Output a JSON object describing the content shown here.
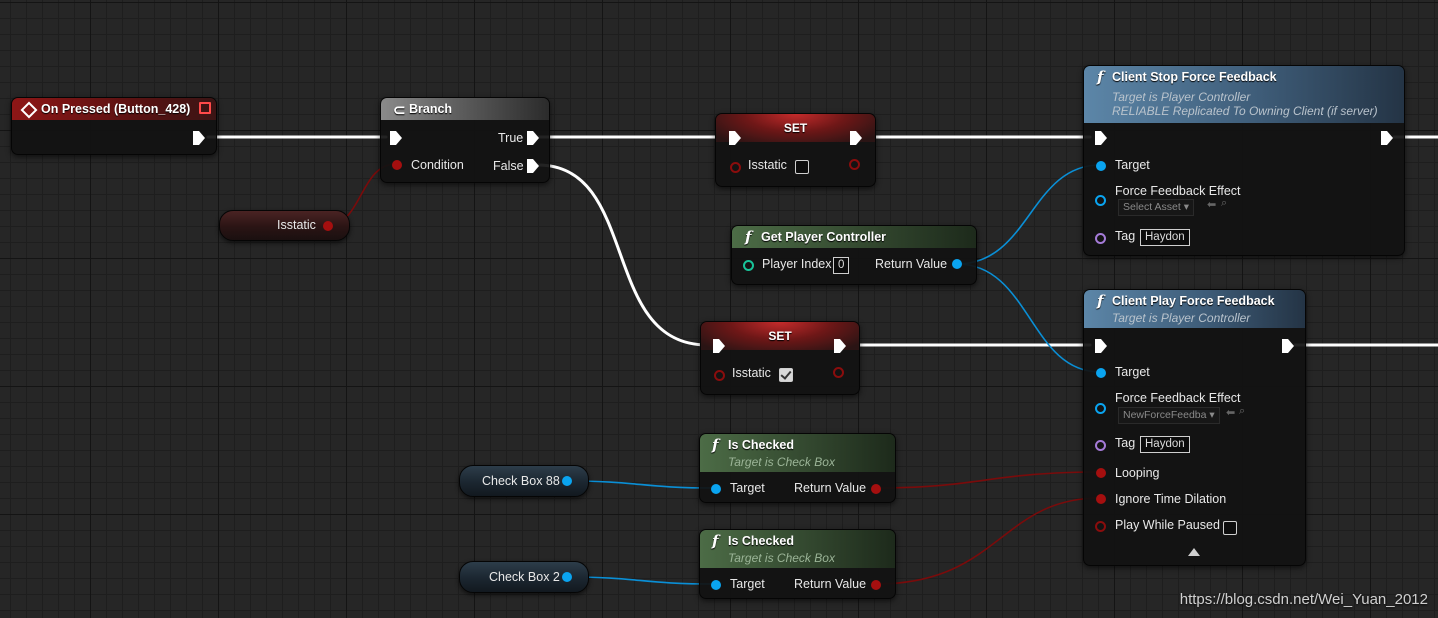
{
  "on_pressed": {
    "title": "On Pressed (Button_428)"
  },
  "branch": {
    "title": "Branch",
    "true_label": "True",
    "false_label": "False",
    "condition_label": "Condition"
  },
  "isstatic_var": {
    "label": "Isstatic"
  },
  "set_top": {
    "title": "SET",
    "var_label": "Isstatic",
    "checked": false
  },
  "set_bottom": {
    "title": "SET",
    "var_label": "Isstatic",
    "checked": true
  },
  "get_player_controller": {
    "title": "Get Player Controller",
    "player_index_label": "Player Index",
    "player_index_value": "0",
    "return_label": "Return Value"
  },
  "client_stop": {
    "title": "Client Stop Force Feedback",
    "subtitle1": "Target is Player Controller",
    "subtitle2": "RELIABLE Replicated To Owning Client (if server)",
    "target_label": "Target",
    "effect_label": "Force Feedback Effect",
    "effect_value": "Select Asset",
    "tag_label": "Tag",
    "tag_value": "Haydon"
  },
  "client_play": {
    "title": "Client Play Force Feedback",
    "subtitle1": "Target is Player Controller",
    "target_label": "Target",
    "effect_label": "Force Feedback Effect",
    "effect_value": "NewForceFeedba",
    "tag_label": "Tag",
    "tag_value": "Haydon",
    "looping_label": "Looping",
    "ignore_label": "Ignore Time Dilation",
    "paused_label": "Play While Paused",
    "paused_checked": false
  },
  "is_checked_1": {
    "title": "Is Checked",
    "subtitle": "Target is Check Box",
    "target_label": "Target",
    "return_label": "Return Value"
  },
  "is_checked_2": {
    "title": "Is Checked",
    "subtitle": "Target is Check Box",
    "target_label": "Target",
    "return_label": "Return Value"
  },
  "checkbox_88": {
    "label": "Check Box 88"
  },
  "checkbox_2": {
    "label": "Check Box 2"
  },
  "watermark": "https://blog.csdn.net/Wei_Yuan_2012",
  "colors": {
    "exec": "#ffffff",
    "bool": "#a50f0f",
    "object": "#0aa4f0",
    "string": "#a57bd8",
    "int": "#18c49a"
  }
}
